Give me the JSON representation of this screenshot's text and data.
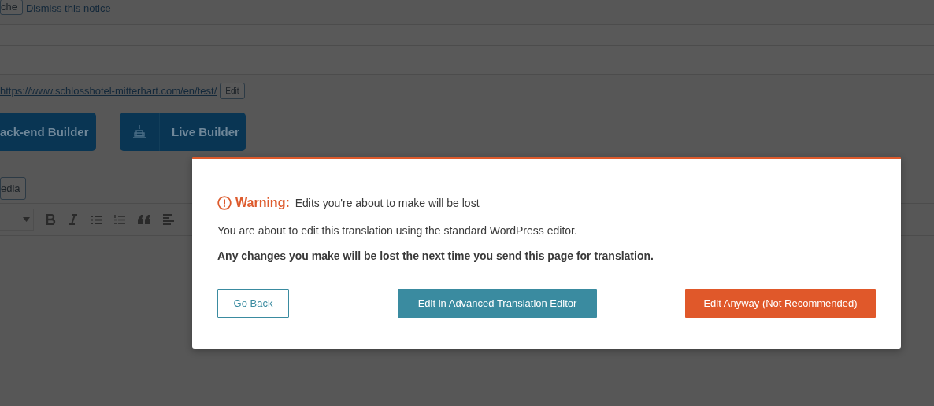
{
  "notice": {
    "button": "che",
    "link": "Dismiss this notice"
  },
  "permalink": {
    "url": "https://www.schlosshotel-mitterhart.com/en/test/",
    "edit_button": "Edit"
  },
  "builders": [
    {
      "label": "ack-end Builder",
      "has_logo": false
    },
    {
      "label": "Live Builder",
      "has_logo": true
    }
  ],
  "add_media": "edia",
  "toolbar": [
    {
      "kind": "dropdown"
    },
    {
      "kind": "bold"
    },
    {
      "kind": "italic"
    },
    {
      "kind": "bullet-list"
    },
    {
      "kind": "numbered-list"
    },
    {
      "kind": "quote"
    },
    {
      "kind": "align-left"
    }
  ],
  "dialog": {
    "warning_label": "Warning:",
    "warning_text": "Edits you're about to make will be lost",
    "message": "You are about to edit this translation using the standard WordPress editor.",
    "bold_message": "Any changes you make will be lost the next time you send this page for translation.",
    "buttons": [
      {
        "label": "Go Back",
        "kind": "outline"
      },
      {
        "label": "Edit in Advanced Translation Editor",
        "kind": "primary"
      },
      {
        "label": "Edit Anyway (Not Recommended)",
        "kind": "danger"
      }
    ]
  }
}
